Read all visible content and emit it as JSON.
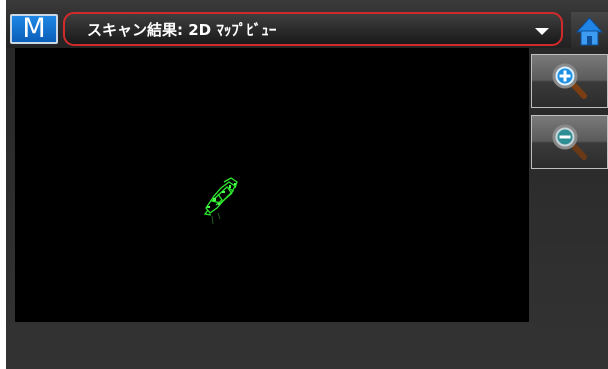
{
  "header": {
    "menu_button_label": "M",
    "view_title": "スキャン結果: 2D ﾏｯﾌﾟﾋﾞｭｰ",
    "view_dropdown_icon": "caret-down-icon",
    "home_icon": "home-icon"
  },
  "toolbar": {
    "zoom_in_icon": "zoom-in-icon",
    "zoom_out_icon": "zoom-out-icon"
  },
  "colors": {
    "accent_blue": "#1a7fe0",
    "highlight_red": "#d12a2a",
    "point_cloud_green": "#2ee82e",
    "map_background": "#000000"
  }
}
